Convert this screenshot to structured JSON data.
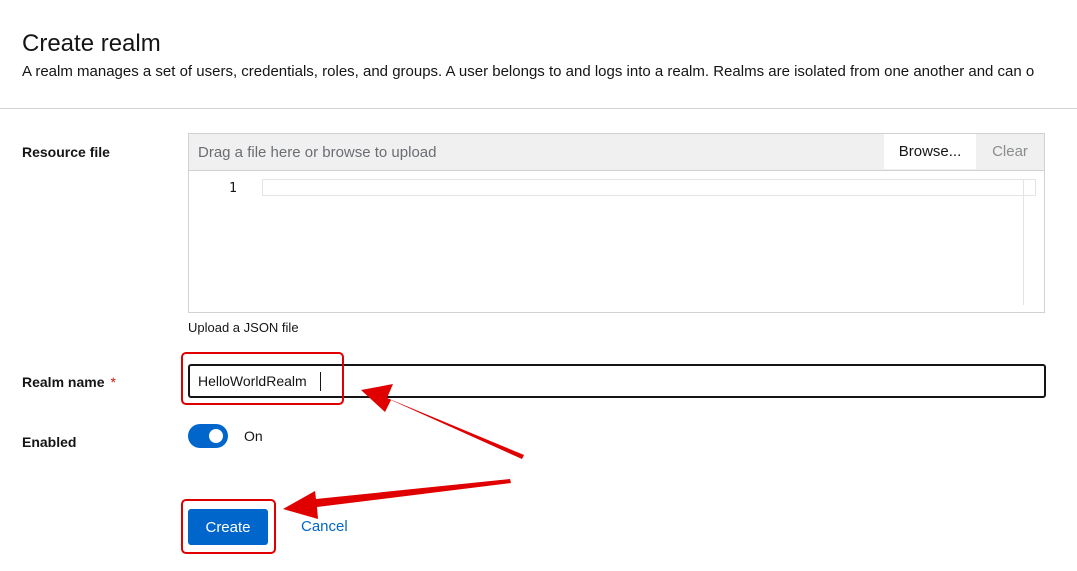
{
  "page": {
    "title": "Create realm",
    "description": "A realm manages a set of users, credentials, roles, and groups. A user belongs to and logs into a realm. Realms are isolated from one another and can o"
  },
  "resource_file": {
    "label": "Resource file",
    "placeholder": "Drag a file here or browse to upload",
    "browse_label": "Browse...",
    "clear_label": "Clear",
    "line_number": "1",
    "helper": "Upload a JSON file"
  },
  "realm_name": {
    "label": "Realm name",
    "required_mark": "*",
    "value": "HelloWorldRealm"
  },
  "enabled": {
    "label": "Enabled",
    "state": "On",
    "checked": true
  },
  "actions": {
    "create_label": "Create",
    "cancel_label": "Cancel"
  },
  "colors": {
    "primary": "#0066cc",
    "annotation": "#e00000",
    "required": "#c9190b"
  },
  "icons": {
    "annotation_arrow": "annotation-arrow-icon"
  }
}
